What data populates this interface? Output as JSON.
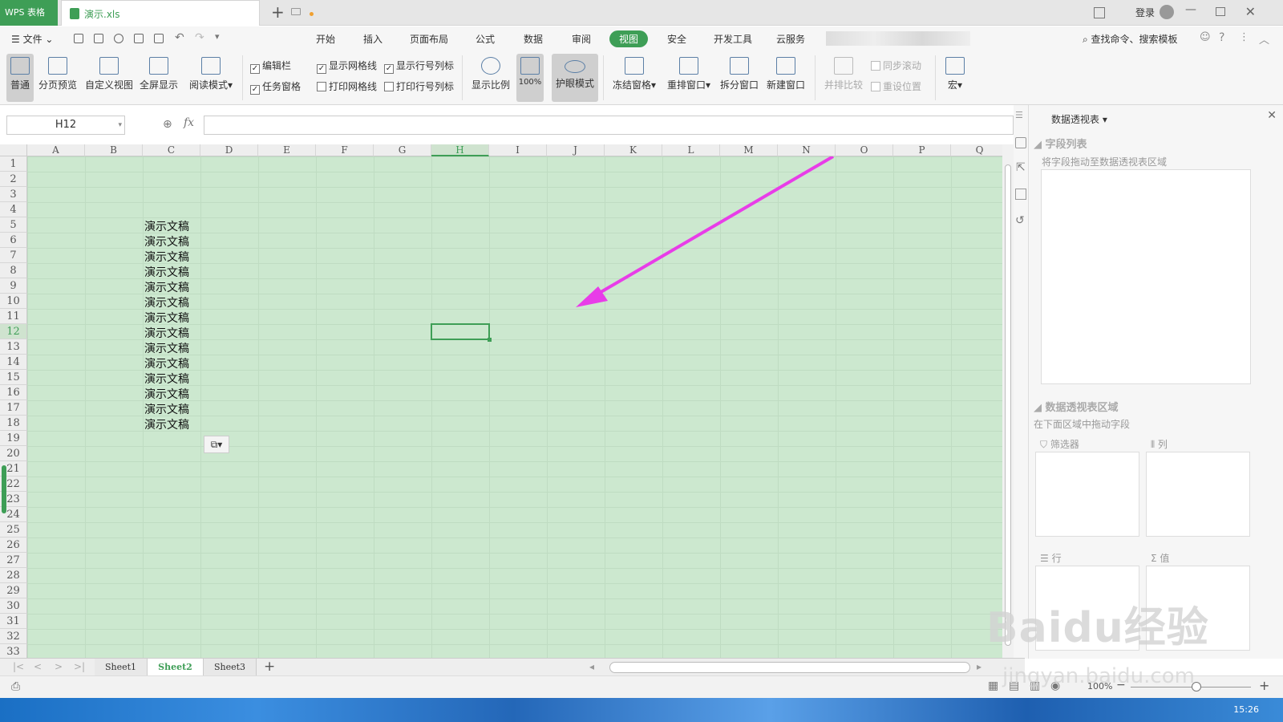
{
  "titlebar": {
    "app_tab": "WPS 表格",
    "file_name": "演示.xls",
    "login": "登录"
  },
  "menubar": {
    "file_label": "文件",
    "tabs": [
      "开始",
      "插入",
      "页面布局",
      "公式",
      "数据",
      "审阅",
      "视图",
      "安全",
      "开发工具",
      "云服务"
    ],
    "active_tab": "视图",
    "search_placeholder": "查找命令、搜索模板"
  },
  "ribbon": {
    "normal": "普通",
    "page_break_preview": "分页预览",
    "custom_view": "自定义视图",
    "full_screen": "全屏显示",
    "reading_mode": "阅读模式",
    "checks": [
      {
        "label": "编辑栏",
        "checked": true
      },
      {
        "label": "任务窗格",
        "checked": true
      },
      {
        "label": "显示网格线",
        "checked": true
      },
      {
        "label": "打印网格线",
        "checked": false
      },
      {
        "label": "显示行号列标",
        "checked": true
      },
      {
        "label": "打印行号列标",
        "checked": false
      }
    ],
    "zoom_ratio": "显示比例",
    "zoom_100": "100%",
    "eye_mode": "护眼模式",
    "freeze_panes": "冻结窗格",
    "rearrange_windows": "重排窗口",
    "split_window": "拆分窗口",
    "new_window": "新建窗口",
    "side_by_side": "并排比较",
    "sync_scroll": "同步滚动",
    "reset_position": "重设位置",
    "macro": "宏"
  },
  "formula_bar": {
    "name_box": "H12",
    "fx": "fx",
    "formula": ""
  },
  "grid": {
    "columns": [
      "A",
      "B",
      "C",
      "D",
      "E",
      "F",
      "G",
      "H",
      "I",
      "J",
      "K",
      "L",
      "M",
      "N",
      "O",
      "P",
      "Q"
    ],
    "rows": [
      "1",
      "2",
      "3",
      "4",
      "5",
      "6",
      "7",
      "8",
      "9",
      "10",
      "11",
      "12",
      "13",
      "14",
      "15",
      "16",
      "17",
      "18",
      "19",
      "20",
      "21",
      "22",
      "23",
      "24",
      "25",
      "26",
      "27",
      "28",
      "29",
      "30",
      "31",
      "32",
      "33"
    ],
    "selected_cell": "H12",
    "cell_text": "演示文稿",
    "filled_rows": [
      5,
      6,
      7,
      8,
      9,
      10,
      11,
      12,
      13,
      14,
      15,
      16,
      17,
      18
    ],
    "background_color": "#cce8cf",
    "arrow_color": "#e83de8"
  },
  "pivot": {
    "title": "数据透视表",
    "field_list": "字段列表",
    "field_hint": "将字段拖动至数据透视表区域",
    "area_title": "数据透视表区域",
    "area_hint": "在下面区域中拖动字段",
    "filter": "筛选器",
    "columns": "列",
    "rows": "行",
    "values": "值"
  },
  "sheets": {
    "tabs": [
      "Sheet1",
      "Sheet2",
      "Sheet3"
    ],
    "active": "Sheet2"
  },
  "status": {
    "zoom": "100%"
  },
  "taskbar": {
    "clock": "15:26"
  },
  "watermark": {
    "brand": "Baidu经验",
    "url": "jingyan.baidu.com"
  },
  "colors": {
    "accent": "#3e9e56"
  }
}
